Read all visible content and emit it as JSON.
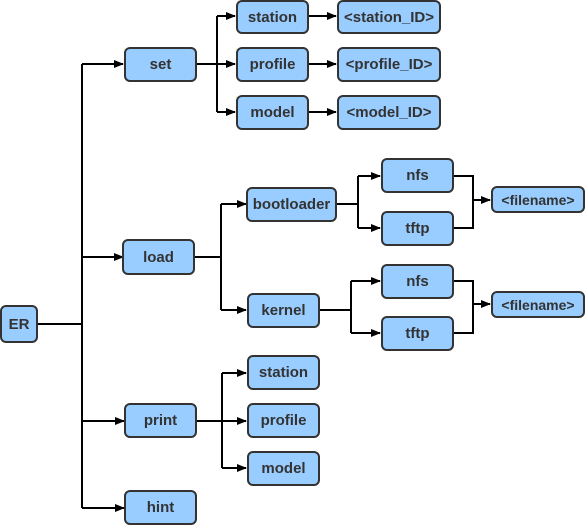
{
  "diagram": {
    "root": "ER",
    "commands": {
      "set": "set",
      "load": "load",
      "print": "print",
      "hint": "hint"
    },
    "set_children": [
      "station",
      "profile",
      "model"
    ],
    "set_args": [
      "<station_ID>",
      "<profile_ID>",
      "<model_ID>"
    ],
    "load_children": [
      "bootloader",
      "kernel"
    ],
    "protocols": [
      "nfs",
      "tftp"
    ],
    "filename": "<filename>",
    "print_children": [
      "station",
      "profile",
      "model"
    ],
    "colors": {
      "node_fill": "#99ccff",
      "node_border": "#333333",
      "edge": "#000000"
    }
  }
}
